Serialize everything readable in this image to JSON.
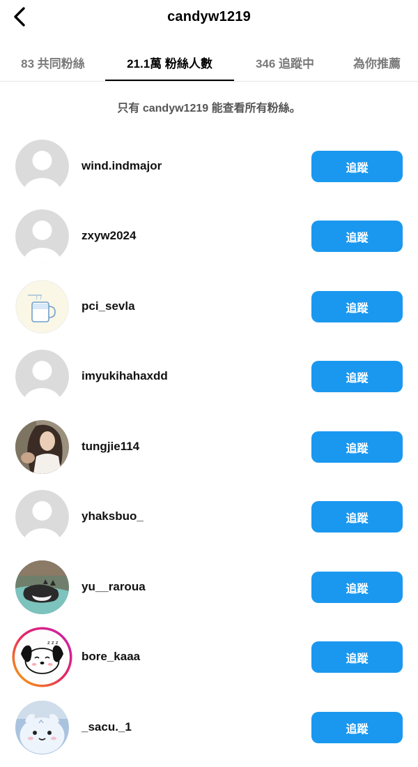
{
  "header": {
    "title": "candyw1219",
    "back_icon": "chevron-left-icon"
  },
  "tabs": [
    {
      "label": "83 共同粉絲",
      "active": false
    },
    {
      "label": "21.1萬 粉絲人數",
      "active": true
    },
    {
      "label": "346 追蹤中",
      "active": false
    },
    {
      "label": "為你推薦",
      "active": false
    }
  ],
  "notice": "只有 candyw1219 能查看所有粉絲。",
  "follow_label": "追蹤",
  "colors": {
    "accent": "#1a98f0",
    "active_tab": "#000000",
    "inactive_tab": "#7a7a7a"
  },
  "followers": [
    {
      "username": "wind.indmajor",
      "avatar": "default-avatar-icon"
    },
    {
      "username": "zxyw2024",
      "avatar": "default-avatar-icon"
    },
    {
      "username": "pci_sevla",
      "avatar": "coffee-mug-drawing"
    },
    {
      "username": "imyukihahaxdd",
      "avatar": "default-avatar-icon"
    },
    {
      "username": "tungjie114",
      "avatar": "person-photo"
    },
    {
      "username": "yhaksbuo_",
      "avatar": "default-avatar-icon"
    },
    {
      "username": "yu__raroua",
      "avatar": "sleeping-cat-photo"
    },
    {
      "username": "bore_kaaa",
      "avatar": "cartoon-dog-with-story-ring"
    },
    {
      "username": "_sacu._1",
      "avatar": "cartoon-hamster"
    }
  ]
}
